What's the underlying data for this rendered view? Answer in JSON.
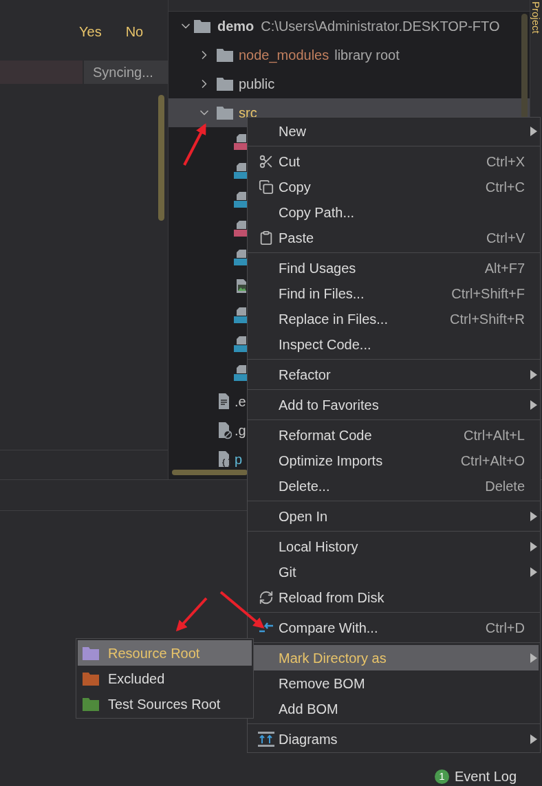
{
  "dialog_buttons": [
    {
      "label": "Yes"
    },
    {
      "label": "No"
    }
  ],
  "status": "Syncing...",
  "tree": {
    "name": "demo",
    "path": "C:\\Users\\Administrator.DESKTOP-FTO",
    "expanded": true,
    "children": [
      {
        "name": "node_modules",
        "hint": "library root",
        "kind": "library",
        "expanded": false,
        "selected": false
      },
      {
        "name": "public",
        "kind": "folder",
        "expanded": false,
        "selected": false
      },
      {
        "name": "src",
        "kind": "folder",
        "expanded": true,
        "selected": true,
        "children": [
          {
            "kind": "sass",
            "selected": false
          },
          {
            "kind": "ts",
            "selected": false
          },
          {
            "kind": "ts",
            "selected": false
          },
          {
            "kind": "sass",
            "selected": false
          },
          {
            "kind": "ts",
            "selected": false
          },
          {
            "kind": "image",
            "selected": false
          },
          {
            "kind": "ts",
            "selected": false
          },
          {
            "kind": "ts",
            "selected": false
          },
          {
            "kind": "ts",
            "selected": false
          }
        ]
      },
      {
        "name": ".e",
        "kind": "text",
        "selected": false
      },
      {
        "name": ".g",
        "kind": "ignore",
        "selected": false
      },
      {
        "name": "p",
        "kind": "json",
        "selected": false
      }
    ]
  },
  "tool_window_stripe": {
    "label": "Project"
  },
  "context_menu": {
    "sections": [
      [
        {
          "label": "New",
          "kind": "plain",
          "submenu": true,
          "selected": false
        }
      ],
      [
        {
          "label": "Cut",
          "kind": "cut",
          "shortcut": "Ctrl+X",
          "selected": false
        },
        {
          "label": "Copy",
          "kind": "copy",
          "shortcut": "Ctrl+C",
          "selected": false
        },
        {
          "label": "Copy Path...",
          "kind": "plain",
          "selected": false
        },
        {
          "label": "Paste",
          "kind": "paste",
          "shortcut": "Ctrl+V",
          "selected": false
        }
      ],
      [
        {
          "label": "Find Usages",
          "kind": "plain",
          "shortcut": "Alt+F7",
          "selected": false
        },
        {
          "label": "Find in Files...",
          "kind": "plain",
          "shortcut": "Ctrl+Shift+F",
          "selected": false
        },
        {
          "label": "Replace in Files...",
          "kind": "plain",
          "shortcut": "Ctrl+Shift+R",
          "selected": false
        },
        {
          "label": "Inspect Code...",
          "kind": "plain",
          "selected": false
        }
      ],
      [
        {
          "label": "Refactor",
          "kind": "plain",
          "submenu": true,
          "selected": false
        }
      ],
      [
        {
          "label": "Add to Favorites",
          "kind": "plain",
          "submenu": true,
          "selected": false
        }
      ],
      [
        {
          "label": "Reformat Code",
          "kind": "plain",
          "shortcut": "Ctrl+Alt+L",
          "selected": false
        },
        {
          "label": "Optimize Imports",
          "kind": "plain",
          "shortcut": "Ctrl+Alt+O",
          "selected": false
        },
        {
          "label": "Delete...",
          "kind": "plain",
          "shortcut": "Delete",
          "selected": false
        }
      ],
      [
        {
          "label": "Open In",
          "kind": "plain",
          "submenu": true,
          "selected": false
        }
      ],
      [
        {
          "label": "Local History",
          "kind": "plain",
          "submenu": true,
          "selected": false
        },
        {
          "label": "Git",
          "kind": "plain",
          "submenu": true,
          "selected": false
        },
        {
          "label": "Reload from Disk",
          "kind": "reload",
          "selected": false
        }
      ],
      [
        {
          "label": "Compare With...",
          "kind": "compare",
          "shortcut": "Ctrl+D",
          "selected": false
        }
      ],
      [
        {
          "label": "Mark Directory as",
          "kind": "plain",
          "submenu": true,
          "selected": true
        },
        {
          "label": "Remove BOM",
          "kind": "plain",
          "selected": false
        },
        {
          "label": "Add BOM",
          "kind": "plain",
          "selected": false
        }
      ],
      [
        {
          "label": "Diagrams",
          "kind": "diagrams",
          "submenu": true,
          "selected": false
        }
      ]
    ]
  },
  "submenu": {
    "items": [
      {
        "label": "Resource Root",
        "color": "#a08fd0",
        "selected": true
      },
      {
        "label": "Excluded",
        "color": "#b5582a",
        "selected": false
      },
      {
        "label": "Test Sources Root",
        "color": "#4f8a3c",
        "selected": false
      }
    ]
  },
  "event_log": {
    "count": "1",
    "label": "Event Log"
  }
}
